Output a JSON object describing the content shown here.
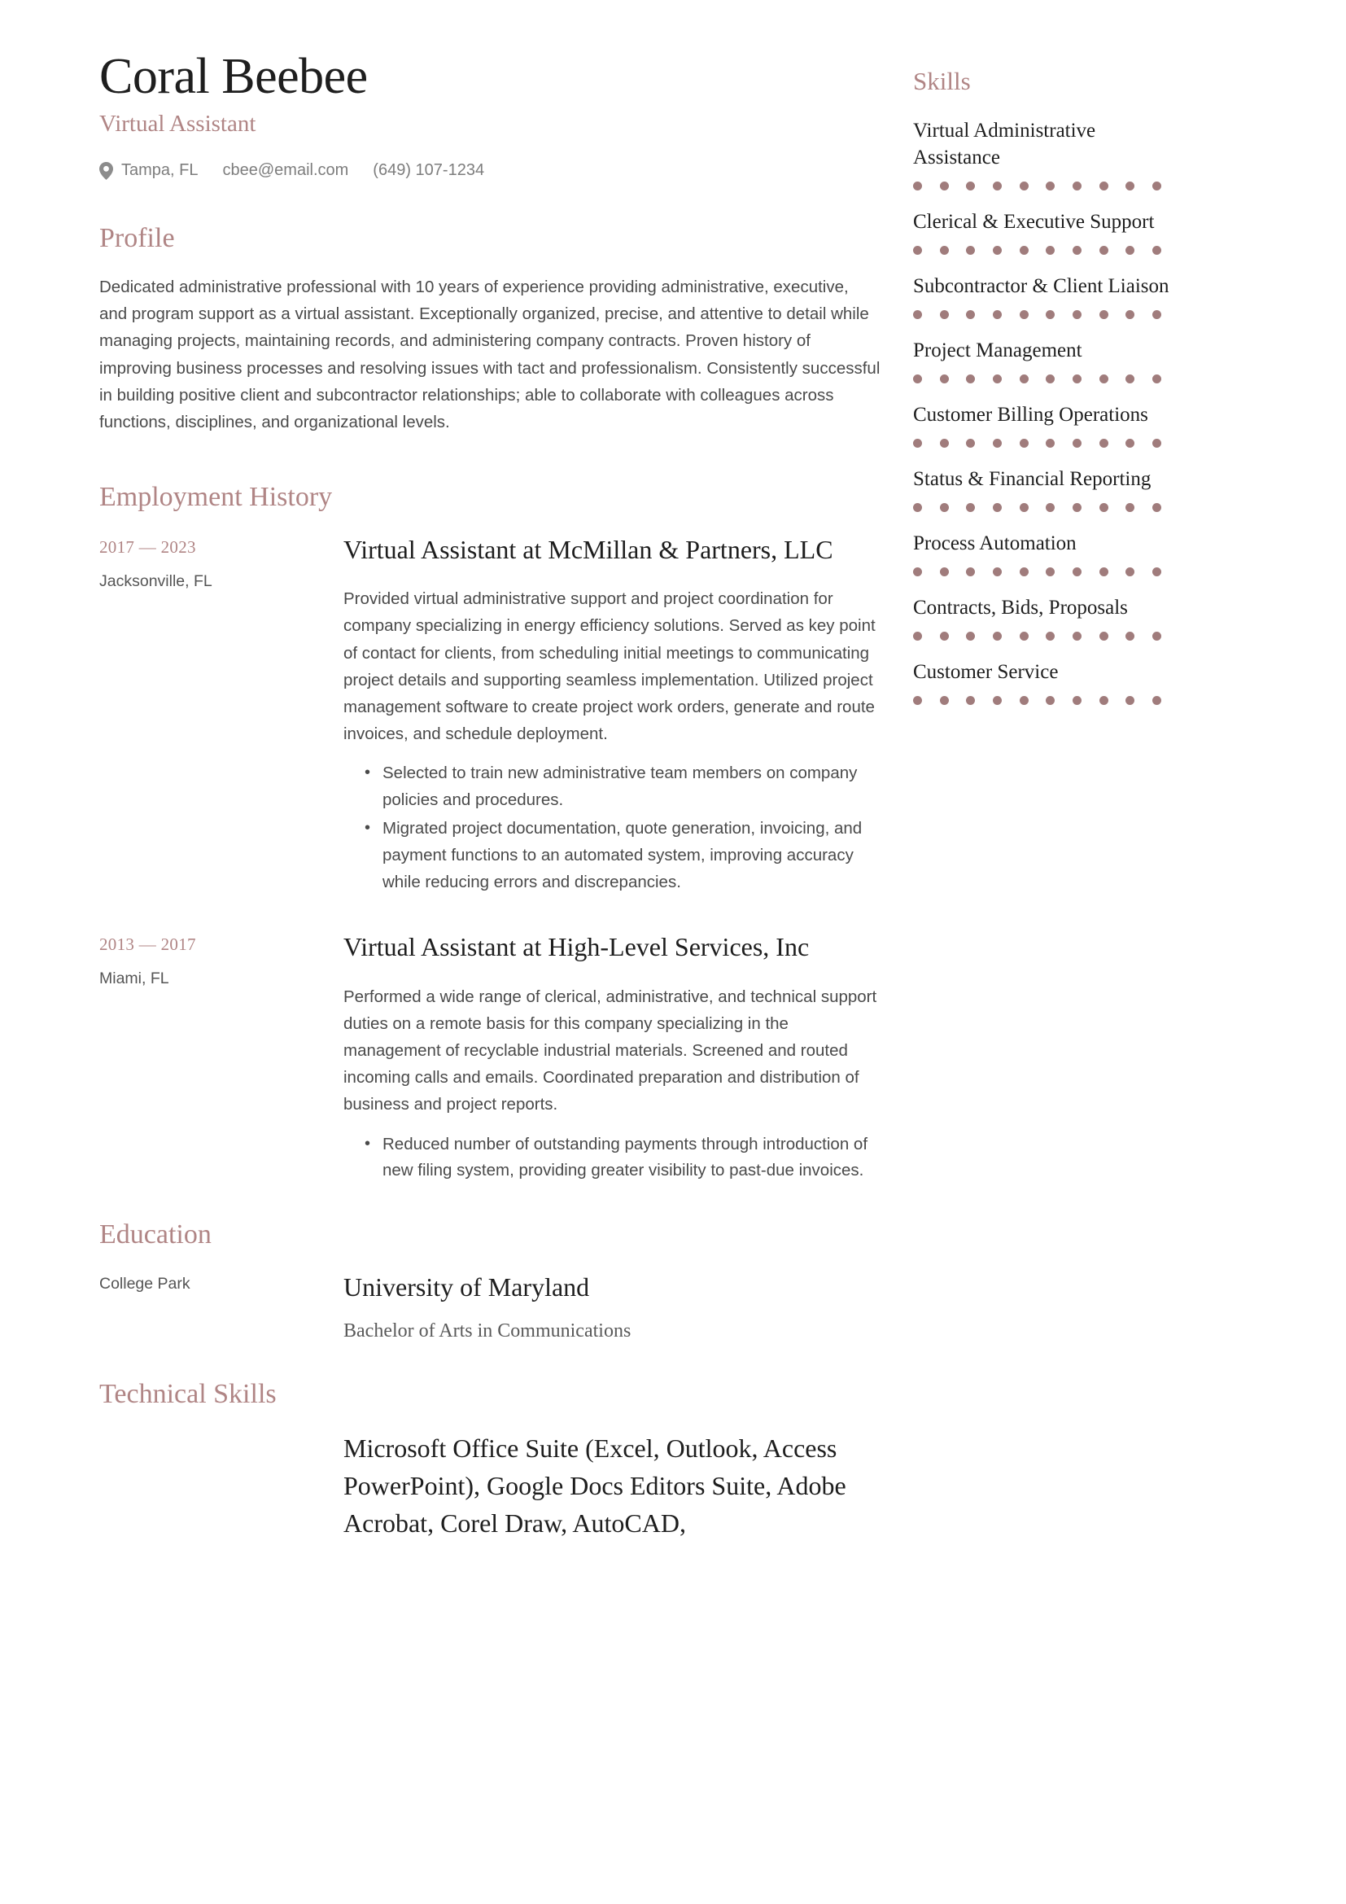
{
  "accent_color": "#b08585",
  "dot_color": "#a07c7c",
  "header": {
    "name": "Coral Beebee",
    "job_title": "Virtual Assistant",
    "location_icon": "location-pin-icon",
    "location": "Tampa, FL",
    "email": "cbee@email.com",
    "phone": "(649) 107-1234"
  },
  "profile": {
    "heading": "Profile",
    "text": "Dedicated administrative professional with 10 years of experience providing administrative, executive, and program support as a virtual assistant. Exceptionally organized, precise, and attentive to detail while managing projects, maintaining records, and administering company contracts. Proven history of improving business processes and resolving issues with tact and professionalism. Consistently successful in building positive client and subcontractor relationships; able to collaborate with colleagues across functions, disciplines, and organizational levels."
  },
  "employment": {
    "heading": "Employment History",
    "entries": [
      {
        "dates": "2017 — 2023",
        "place": "Jacksonville, FL",
        "title": "Virtual Assistant at McMillan & Partners, LLC",
        "description": "Provided virtual administrative support and project coordination for company specializing in energy efficiency solutions. Served as key point of contact for clients, from scheduling initial meetings to communicating project details and supporting seamless implementation. Utilized project management software to create project work orders, generate and route invoices, and schedule deployment.",
        "bullets": [
          "Selected to train new administrative team members on company policies and procedures.",
          "Migrated project documentation, quote generation, invoicing, and payment functions to an automated system, improving accuracy while reducing errors and discrepancies."
        ]
      },
      {
        "dates": "2013 — 2017",
        "place": "Miami, FL",
        "title": "Virtual Assistant at High-Level Services, Inc",
        "description": "Performed a wide range of clerical, administrative, and technical support duties on a remote basis for this company specializing in the management of recyclable industrial materials. Screened and routed incoming calls and emails. Coordinated preparation and distribution of business and project reports.",
        "bullets": [
          "Reduced number of outstanding payments through introduction of new filing system, providing greater visibility to past-due invoices."
        ]
      }
    ]
  },
  "education": {
    "heading": "Education",
    "entries": [
      {
        "place": "College Park",
        "school": "University of Maryland",
        "degree": "Bachelor of Arts in Communications"
      }
    ]
  },
  "technical_skills": {
    "heading": "Technical Skills",
    "text": "Microsoft Office Suite (Excel, Outlook, Access PowerPoint), Google Docs Editors Suite, Adobe Acrobat, Corel Draw, AutoCAD,"
  },
  "skills": {
    "heading": "Skills",
    "max_dots": 10,
    "items": [
      {
        "label": "Virtual Administrative Assistance",
        "rating": 10
      },
      {
        "label": "Clerical & Executive Support",
        "rating": 10
      },
      {
        "label": "Subcontractor & Client Liaison",
        "rating": 10
      },
      {
        "label": "Project Management",
        "rating": 10
      },
      {
        "label": "Customer Billing Operations",
        "rating": 10
      },
      {
        "label": "Status & Financial Reporting",
        "rating": 10
      },
      {
        "label": "Process Automation",
        "rating": 10
      },
      {
        "label": "Contracts, Bids, Proposals",
        "rating": 10
      },
      {
        "label": "Customer Service",
        "rating": 10
      }
    ]
  }
}
